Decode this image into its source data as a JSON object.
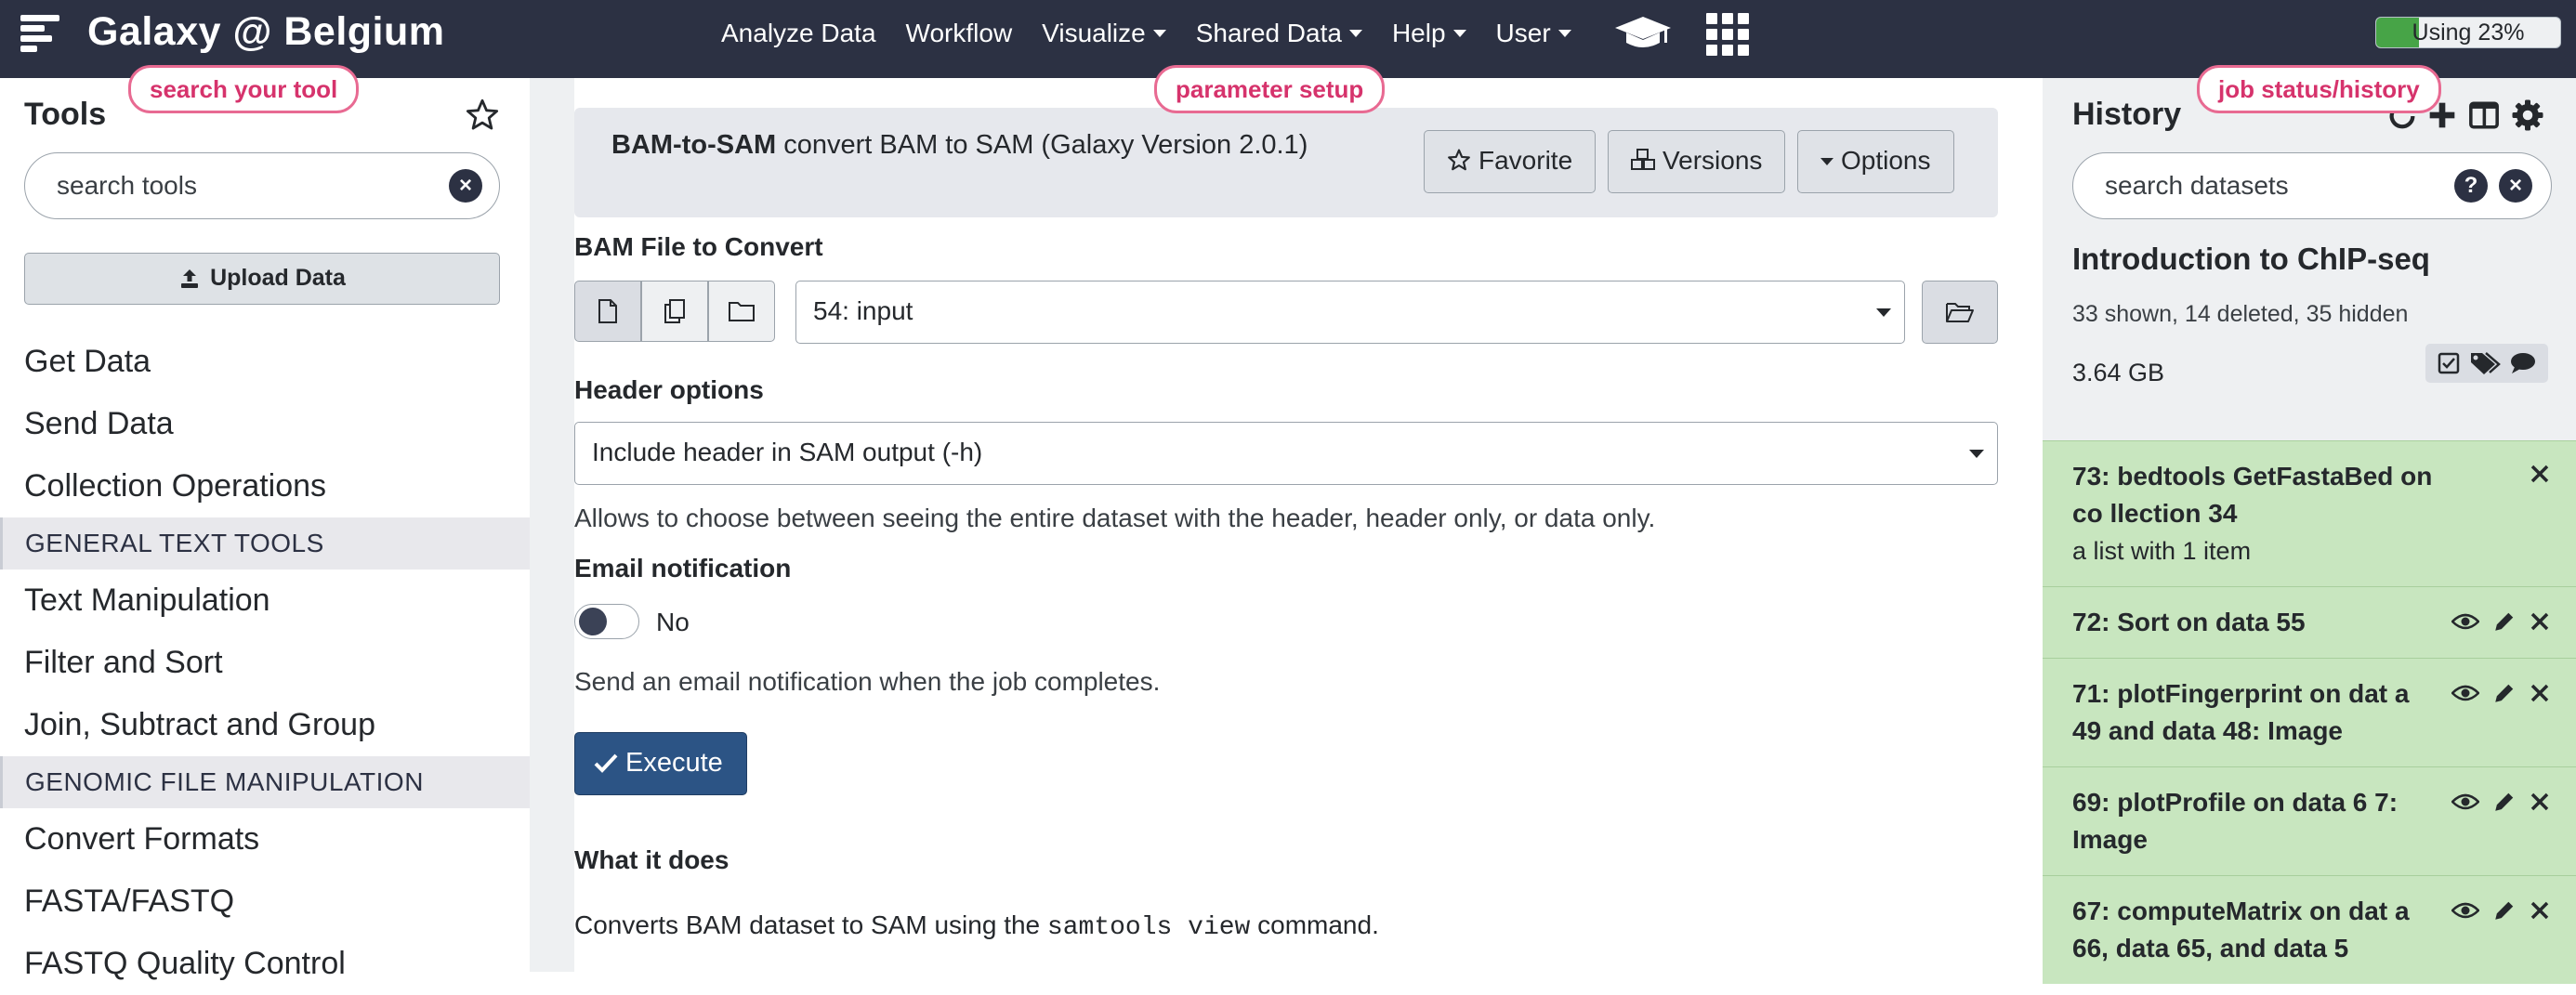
{
  "masthead": {
    "brand": "Galaxy @ Belgium",
    "nav": [
      "Analyze Data",
      "Workflow",
      "Visualize",
      "Shared Data",
      "Help",
      "User"
    ],
    "nav_dropdowns": [
      false,
      false,
      true,
      true,
      true,
      true
    ],
    "quota_label": "Using 23%",
    "quota_percent": 23,
    "quota_color": "#47a447",
    "bg_color": "#2c3143"
  },
  "callouts": {
    "tools": "search your tool",
    "params": "parameter setup",
    "history": "job status/history"
  },
  "tools_panel": {
    "title": "Tools",
    "search_placeholder": "search tools",
    "upload_label": "Upload Data",
    "items": [
      {
        "type": "item",
        "label": "Get Data"
      },
      {
        "type": "item",
        "label": "Send Data"
      },
      {
        "type": "item",
        "label": "Collection Operations"
      },
      {
        "type": "section",
        "label": "GENERAL TEXT TOOLS"
      },
      {
        "type": "item",
        "label": "Text Manipulation"
      },
      {
        "type": "item",
        "label": "Filter and Sort"
      },
      {
        "type": "item",
        "label": "Join, Subtract and Group"
      },
      {
        "type": "section",
        "label": "GENOMIC FILE MANIPULATION"
      },
      {
        "type": "item",
        "label": "Convert Formats"
      },
      {
        "type": "item",
        "label": "FASTA/FASTQ"
      },
      {
        "type": "item",
        "label": "FASTQ Quality Control"
      }
    ]
  },
  "tool_form": {
    "tool_name": "BAM-to-SAM",
    "tool_desc": "convert BAM to SAM (Galaxy Version 2.0.1)",
    "favorite_label": "Favorite",
    "versions_label": "Versions",
    "options_label": "Options",
    "bam_label": "BAM File to Convert",
    "bam_value": "54: input",
    "header_label": "Header options",
    "header_value": "Include header in SAM output (-h)",
    "header_help": "Allows to choose between seeing the entire dataset with the header, header only, or data only.",
    "email_label": "Email notification",
    "email_value": "No",
    "email_help": "Send an email notification when the job completes.",
    "execute_label": "Execute",
    "what_title": "What it does",
    "what_pre": "Converts BAM dataset to SAM using the",
    "what_code": "samtools view",
    "what_post": "command."
  },
  "history": {
    "title": "History",
    "search_placeholder": "search datasets",
    "name": "Introduction to ChIP-seq",
    "meta": "33 shown, 14 deleted, 35 hidden",
    "size": "3.64 GB",
    "ok_color": "#c8e6bf",
    "datasets": [
      {
        "title": "73: bedtools GetFastaBed on co llection 34",
        "sub": "a list with 1 item",
        "actions": "delete"
      },
      {
        "title": "72: Sort on data 55",
        "sub": "",
        "actions": "full"
      },
      {
        "title": "71: plotFingerprint on dat a 49 and data 48: Image",
        "sub": "",
        "actions": "full"
      },
      {
        "title": "69: plotProfile on data 6 7: Image",
        "sub": "",
        "actions": "full"
      },
      {
        "title": "67: computeMatrix on dat a 66, data 65, and data 5",
        "sub": "",
        "actions": "full"
      }
    ]
  }
}
